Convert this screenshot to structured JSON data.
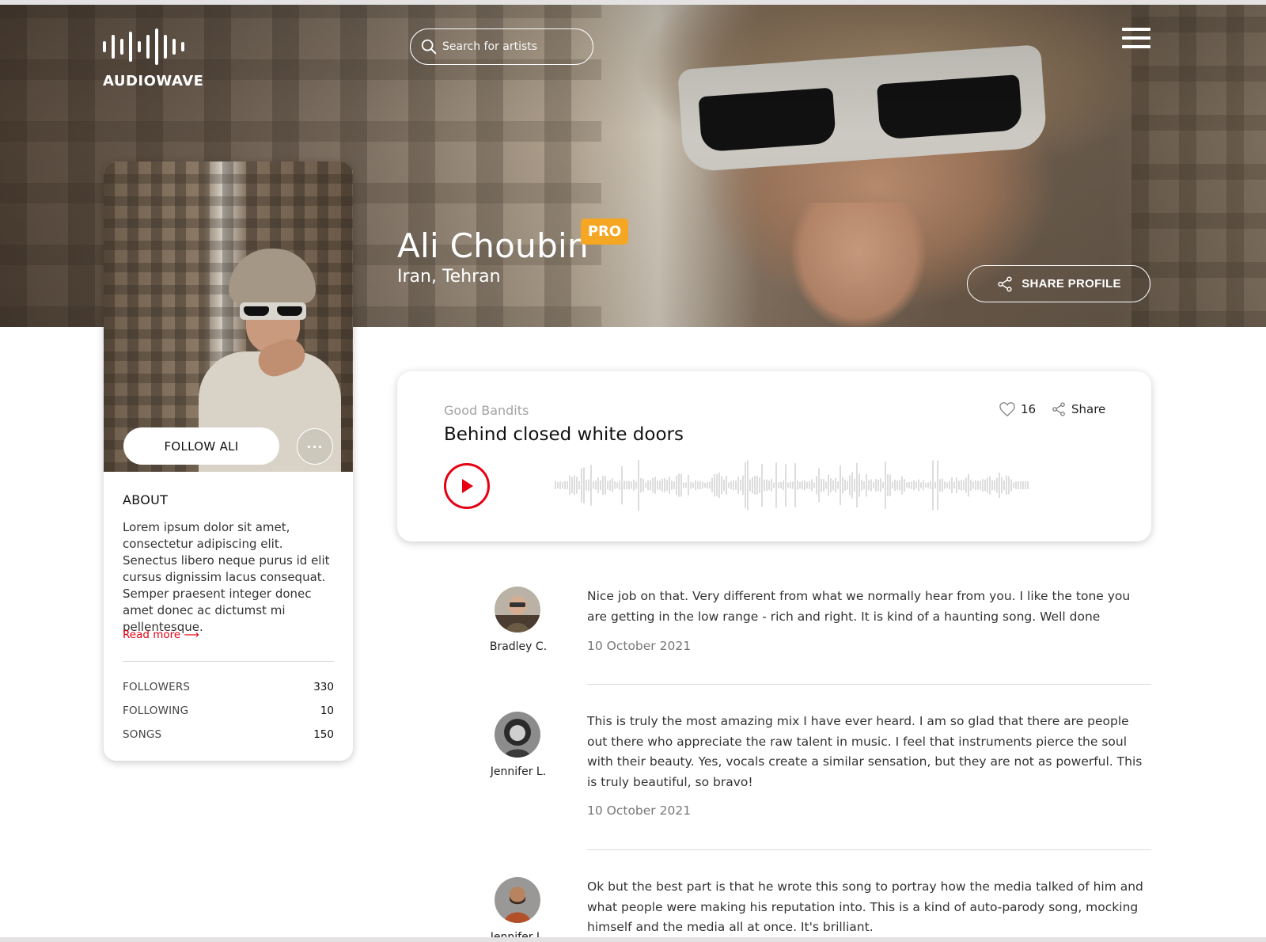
{
  "header": {
    "logo_text": "AUDIOWAVE",
    "search_placeholder": "Search for artists",
    "menu_icon": "hamburger-menu-icon"
  },
  "artist": {
    "name": "Ali Choubin",
    "badge": "PRO",
    "location": "Iran, Tehran",
    "share_profile_label": "SHARE PROFILE"
  },
  "profile_card": {
    "follow_label": "FOLLOW ALI",
    "more_label": "···",
    "about_title": "ABOUT",
    "about_text": "Lorem ipsum dolor sit amet, consectetur adipiscing elit. Senectus libero neque purus id elit cursus dignissim lacus consequat. Semper praesent integer donec amet donec ac dictumst mi pellentesque.",
    "read_more": "Read more ⟶",
    "stats": [
      {
        "label": "FOLLOWERS",
        "value": "330"
      },
      {
        "label": "FOLLOWING",
        "value": "10"
      },
      {
        "label": "SONGS",
        "value": "150"
      }
    ]
  },
  "track": {
    "artist": "Good Bandits",
    "title": "Behind closed white doors",
    "likes": "16",
    "share_label": "Share"
  },
  "comments": [
    {
      "author": "Bradley C.",
      "text": "Nice job on that. Very different from what we normally hear from you. I like the tone you are getting in the low range - rich and right. It is kind of a haunting song. Well done",
      "date": "10 October 2021"
    },
    {
      "author": "Jennifer L.",
      "text": "This is truly the most amazing mix I have ever heard. I am so glad that there are people out there who appreciate the raw talent in music. I feel that instruments pierce the soul with their beauty. Yes, vocals create a similar sensation, but they are not as powerful. This is truly beautiful, so bravo!",
      "date": "10 October 2021"
    },
    {
      "author": "Jennifer L.",
      "text": "Ok but the best part is that he wrote this song to portray how the media talked of him and what people were making his reputation into. This is a kind of auto-parody song, mocking himself and the media all at once. It's brilliant.",
      "date": ""
    }
  ],
  "colors": {
    "accent_red": "#e60012",
    "pro_badge": "#f5a623"
  }
}
